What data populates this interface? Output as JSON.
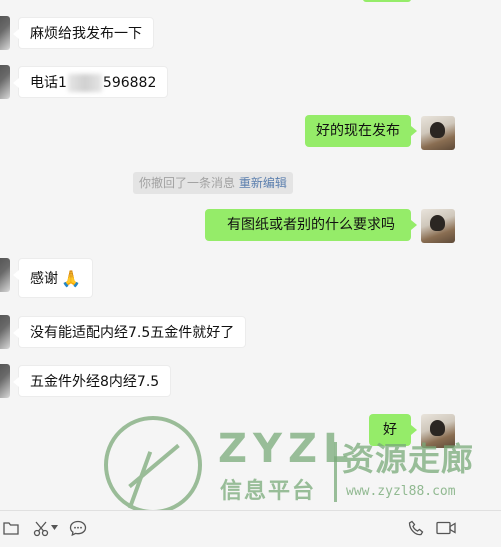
{
  "messages": [
    {
      "side": "in",
      "text": "麻烦给我发布一下"
    },
    {
      "side": "in",
      "text_prefix": "电话1",
      "text_suffix": "596882"
    },
    {
      "side": "out",
      "text": "好的现在发布"
    },
    {
      "side": "system",
      "text": "你撤回了一条消息",
      "link": "重新编辑"
    },
    {
      "side": "out",
      "text": "有图纸或者别的什么要求吗"
    },
    {
      "side": "in",
      "text": "感谢",
      "emoji": "🙏"
    },
    {
      "side": "in",
      "text": "没有能适配内经7.5五金件就好了"
    },
    {
      "side": "in",
      "text": "五金件外经8内经7.5"
    },
    {
      "side": "out",
      "text": "好"
    }
  ],
  "watermark": {
    "brand": "ZYZL",
    "sub": "信息平台",
    "right": "资源走廊",
    "url": "www.zyzl88.com"
  },
  "toolbar": {
    "icons": [
      "folder-icon",
      "scissors-icon",
      "chevron-down-icon",
      "chat-bubble-icon",
      "phone-icon",
      "video-call-icon"
    ]
  },
  "colors": {
    "out_bubble": "#95ec69",
    "in_bubble": "#ffffff",
    "background": "#f5f5f5"
  }
}
